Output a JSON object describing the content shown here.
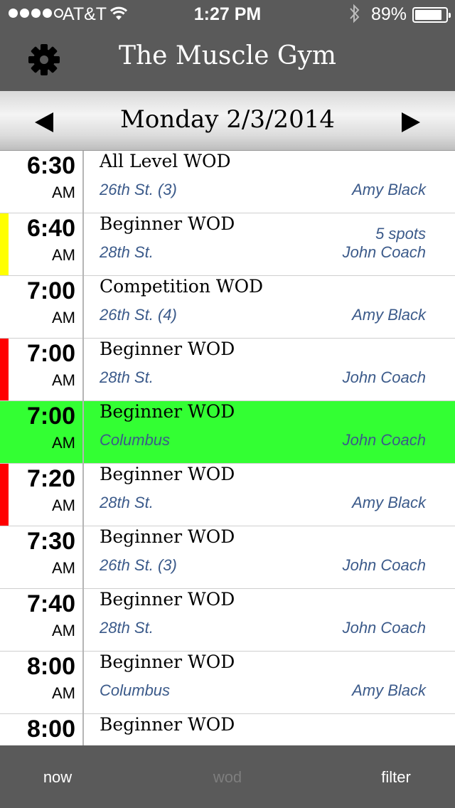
{
  "status_bar": {
    "carrier": "AT&T",
    "time": "1:27 PM",
    "battery": "89%",
    "battery_level": 0.89
  },
  "header": {
    "title": "The Muscle Gym",
    "settings_icon": "gear-icon"
  },
  "date_bar": {
    "date": "Monday 2/3/2014",
    "prev_icon": "left-triangle-icon",
    "next_icon": "right-triangle-icon"
  },
  "schedule": [
    {
      "time": "6:30",
      "ampm": "AM",
      "name": "All Level WOD",
      "location": "26th St. (3)",
      "coach": "Amy Black",
      "spots": "",
      "flag": "",
      "selected": false
    },
    {
      "time": "6:40",
      "ampm": "AM",
      "name": "Beginner WOD",
      "location": "28th St.",
      "coach": "John Coach",
      "spots": "5 spots",
      "flag": "#ffff00",
      "selected": false
    },
    {
      "time": "7:00",
      "ampm": "AM",
      "name": "Competition WOD",
      "location": "26th St. (4)",
      "coach": "Amy Black",
      "spots": "",
      "flag": "",
      "selected": false
    },
    {
      "time": "7:00",
      "ampm": "AM",
      "name": "Beginner WOD",
      "location": "28th St.",
      "coach": "John Coach",
      "spots": "",
      "flag": "#ff0000",
      "selected": false
    },
    {
      "time": "7:00",
      "ampm": "AM",
      "name": "Beginner WOD",
      "location": "Columbus",
      "coach": "John Coach",
      "spots": "",
      "flag": "",
      "selected": true
    },
    {
      "time": "7:20",
      "ampm": "AM",
      "name": "Beginner WOD",
      "location": "28th St.",
      "coach": "Amy Black",
      "spots": "",
      "flag": "#ff0000",
      "selected": false
    },
    {
      "time": "7:30",
      "ampm": "AM",
      "name": "Beginner WOD",
      "location": "26th St. (3)",
      "coach": "John Coach",
      "spots": "",
      "flag": "",
      "selected": false
    },
    {
      "time": "7:40",
      "ampm": "AM",
      "name": "Beginner WOD",
      "location": "28th St.",
      "coach": "John Coach",
      "spots": "",
      "flag": "",
      "selected": false
    },
    {
      "time": "8:00",
      "ampm": "AM",
      "name": "Beginner WOD",
      "location": "Columbus",
      "coach": "Amy Black",
      "spots": "",
      "flag": "",
      "selected": false
    },
    {
      "time": "8:00",
      "ampm": "AM",
      "name": "Beginner WOD",
      "location": "",
      "coach": "",
      "spots": "",
      "flag": "",
      "selected": false
    }
  ],
  "tabs": {
    "now": "now",
    "wod": "wod",
    "filter": "filter"
  },
  "colors": {
    "header_bg": "#5a5a5a",
    "selected_row": "#33ff33",
    "detail_text": "#3b5a8a",
    "flag_yellow": "#ffff00",
    "flag_red": "#ff0000"
  }
}
